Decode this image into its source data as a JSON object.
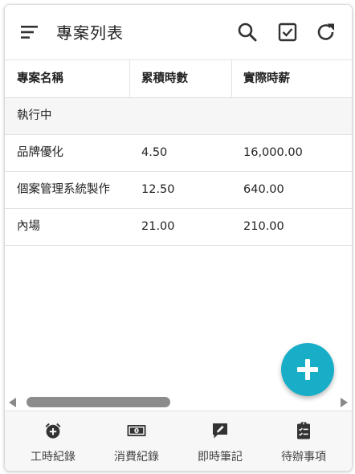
{
  "appbar": {
    "title": "專案列表",
    "menu_icon": "menu-icon",
    "actions": [
      "search-icon",
      "check-box-icon",
      "refresh-icon"
    ]
  },
  "table": {
    "headers": [
      "專案名稱",
      "累積時數",
      "實際時薪"
    ],
    "group_label": "執行中",
    "rows": [
      {
        "name": "品牌優化",
        "hours": "4.50",
        "rate": "16,000.00"
      },
      {
        "name": "個案管理系統製作",
        "hours": "12.50",
        "rate": "640.00"
      },
      {
        "name": "內場",
        "hours": "21.00",
        "rate": "210.00"
      }
    ]
  },
  "fab": {
    "icon": "plus-icon",
    "color": "#19aec7"
  },
  "bottom_nav": {
    "items": [
      {
        "label": "工時紀錄",
        "icon": "alarm-add-icon"
      },
      {
        "label": "消費紀錄",
        "icon": "money-icon"
      },
      {
        "label": "即時筆記",
        "icon": "note-edit-icon"
      },
      {
        "label": "待辦事項",
        "icon": "clipboard-checklist-icon"
      }
    ]
  },
  "colors": {
    "accent": "#19aec7",
    "icon": "#333333"
  }
}
